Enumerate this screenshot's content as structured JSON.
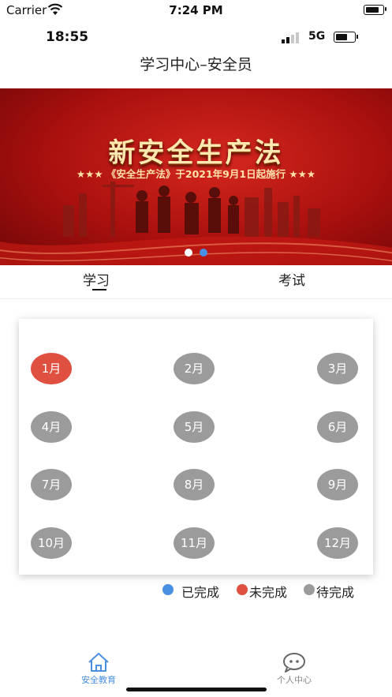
{
  "device": {
    "carrier": "Carrier",
    "time": "7:24 PM"
  },
  "app_status": {
    "time": "18:55",
    "network": "5G"
  },
  "header": {
    "title": "学习中心–安全员"
  },
  "banner": {
    "title": "新安全生产法",
    "subtitle": "★★★ 《安全生产法》于2021年9月1日起施行 ★★★",
    "active_dot": 2,
    "dot_count": 2
  },
  "tabs": [
    {
      "label": "学习",
      "active": true
    },
    {
      "label": "考试",
      "active": false
    }
  ],
  "months": [
    {
      "label": "1月",
      "status": "incomplete"
    },
    {
      "label": "2月",
      "status": "pending"
    },
    {
      "label": "3月",
      "status": "pending"
    },
    {
      "label": "4月",
      "status": "pending"
    },
    {
      "label": "5月",
      "status": "pending"
    },
    {
      "label": "6月",
      "status": "pending"
    },
    {
      "label": "7月",
      "status": "pending"
    },
    {
      "label": "8月",
      "status": "pending"
    },
    {
      "label": "9月",
      "status": "pending"
    },
    {
      "label": "10月",
      "status": "pending"
    },
    {
      "label": "11月",
      "status": "pending"
    },
    {
      "label": "12月",
      "status": "pending"
    }
  ],
  "legend": {
    "completed": "已完成",
    "incomplete": "未完成",
    "pending": "待完成"
  },
  "colors": {
    "completed": "#4a90e2",
    "incomplete": "#e05040",
    "pending": "#9b9b9b",
    "nav_active": "#4a90e2",
    "nav_inactive": "#888888"
  },
  "bottom_nav": [
    {
      "label": "安全教育",
      "icon": "home-icon",
      "active": true
    },
    {
      "label": "个人中心",
      "icon": "chat-face-icon",
      "active": false
    }
  ]
}
